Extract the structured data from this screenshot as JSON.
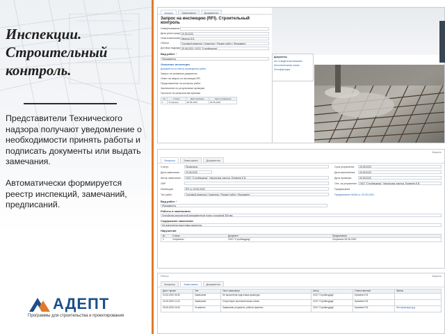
{
  "left": {
    "title_lines": [
      "Инспекции.",
      "Строительный",
      "контроль."
    ],
    "paragraph1": "Представители Технического надзора получают уведомление о необходимости принять работы и подписать документы или выдать замечания.",
    "paragraph2": "Автоматически формируется реестр инспекций, замечаний, предписаний.",
    "logo_word": "АДЕПТ",
    "logo_tagline": "Программы для строительства и проектирования",
    "colors": {
      "accent": "#e07a2a",
      "logo_blue": "#1d4f8a",
      "logo_orange": "#e07a2a"
    }
  },
  "shot1": {
    "tabs": [
      "Запрос",
      "Замечания",
      "Документы"
    ],
    "heading": "Запрос на инспекцию (RFI). Строительный контроль",
    "fields": [
      {
        "label": "Номер/название этапа",
        "value": ""
      },
      {
        "label": "Дата регистрации",
        "value": "20.05.2020"
      },
      {
        "label": "Ответственный/исполнитель",
        "value": "Иванов Д.И."
      },
      {
        "label": "Объект",
        "value": "Торговый комплекс | Комплекс | Раздел работ | Фундамент"
      },
      {
        "label": "Договор подрядчика",
        "value": "29.06.2020 | ООО \"Стройподряд\""
      }
    ],
    "work_type_label": "Вид работ",
    "work_type_value": "Фундаменты",
    "list_items": [
      "Описание инспекции",
      "Документы по месту проведения работ",
      "Запрос на активные документы",
      "Ответ на запрос по инспекции RFI",
      "Представление на контроль работ",
      "Заключение по результатам проверки",
      "Протокол по результатам приемки"
    ],
    "table_head": [
      "№",
      "Статус",
      "Дата приемки",
      "Срок устранения"
    ],
    "table_row": [
      "1",
      "Устранено",
      "20.05.2020",
      "26.05.2020"
    ],
    "docs": [
      "Документы",
      "Акт освидетельствования",
      "Исполнительная схема",
      "Фотофиксация"
    ]
  },
  "shot2": {
    "tabs": [
      "Запросы",
      "Замечания",
      "Документы"
    ],
    "top_right": "Закрыть",
    "left_fields": [
      {
        "label": "Статус",
        "value": "Проверено"
      },
      {
        "label": "Дата замечания",
        "value": "20.05.2020"
      },
      {
        "label": "Автор замечания",
        "value": "ООО \"Стройподряд\", Начальник участка, Еремеев Е.В."
      },
      {
        "label": "ОКР",
        "value": ""
      },
      {
        "label": "Инспекция",
        "value": "RFI от 20.05.2020"
      },
      {
        "label": "Тип работ",
        "value": "Торговый комплекс | Комплекс | Раздел работ | Фундамент"
      }
    ],
    "right_fields": [
      {
        "label": "Срок устранения",
        "value": "26.05.2020"
      },
      {
        "label": "Дата выполнения",
        "value": "25.05.2020"
      },
      {
        "label": "Дата проверки",
        "value": "26.05.2020"
      },
      {
        "label": "Отв. за устранение",
        "value": "ООО \"Стройподряд\", Начальник участка, Еремеев Е.В."
      },
      {
        "label": "Предписание",
        "value": "Предписание №006 от 20.05.2020"
      }
    ],
    "work_type_label": "Вид работ",
    "work_type_value": "Фундаменты",
    "work_label": "Работы в замечаниях",
    "work_value": "Устройство монолитной фундаментной плиты толщиной 300 мм",
    "remark_label": "Содержание замечания",
    "remark_value": "Не выполнена подготовка арматуры",
    "grid_label": "Нарушения",
    "grid_head": [
      "№",
      "Статус",
      "Документ",
      "Предписание"
    ],
    "grid_rows": [
      [
        "1",
        "Устранено",
        "ООО \"Стройподряд\"",
        "Устранено 26.05.2020"
      ]
    ]
  },
  "shot3": {
    "tabs": [
      "Запросы",
      "Замечания",
      "Документы"
    ],
    "top_left": "Реестр",
    "top_right": "Закрыть",
    "table_head": [
      "Дата / время",
      "Тип",
      "Текст замечания",
      "Автор",
      "Ответственный",
      "Файлы"
    ],
    "rows": [
      [
        "20.05.2020 09:30",
        "Замечание",
        "Не выполнена подготовка арматуры",
        "ООО \"Стройподряд\"",
        "Еремеев Е.В.",
        ""
      ],
      [
        "21.05.2020 11:15",
        "Замечание",
        "Отсутствует исполнительная схема",
        "ООО \"Стройподряд\"",
        "Еремеев Е.В.",
        ""
      ],
      [
        "26.05.2020 16:40",
        "Устранено",
        "Замечание устранено, работы приняты",
        "ООО \"Стройподряд\"",
        "Еремеев Е.В.",
        "Фотофиксация.jpg"
      ]
    ]
  }
}
